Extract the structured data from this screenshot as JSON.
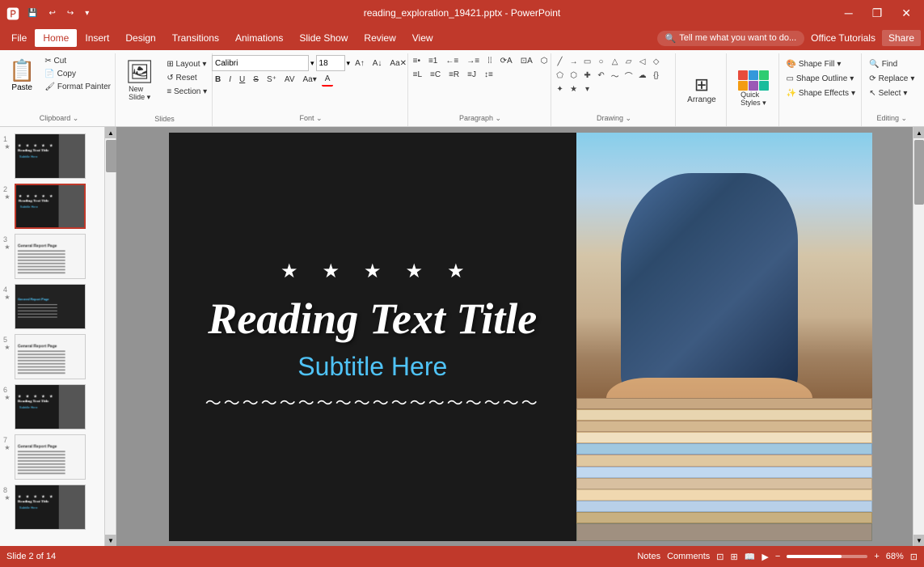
{
  "titlebar": {
    "filename": "reading_exploration_19421.pptx - PowerPoint",
    "qat": [
      "save",
      "undo",
      "redo",
      "customize"
    ],
    "winbtns": [
      "minimize",
      "restore",
      "close"
    ]
  },
  "menubar": {
    "items": [
      "File",
      "Home",
      "Insert",
      "Design",
      "Transitions",
      "Animations",
      "Slide Show",
      "Review",
      "View"
    ],
    "active": "Home",
    "help_placeholder": "Tell me what you want to do...",
    "office_tutorials": "Office Tutorials",
    "share": "Share"
  },
  "ribbon": {
    "groups": [
      {
        "name": "Clipboard",
        "label": "Clipboard",
        "buttons": [
          "Paste",
          "Cut",
          "Copy",
          "Format Painter"
        ]
      },
      {
        "name": "Slides",
        "label": "Slides",
        "buttons": [
          "New Slide",
          "Layout",
          "Reset",
          "Section"
        ]
      },
      {
        "name": "Font",
        "label": "Font",
        "font_name": "Calibri",
        "font_size": "18",
        "buttons": [
          "Bold",
          "Italic",
          "Underline",
          "Strikethrough",
          "Shadow",
          "Char Spacing",
          "Font Color",
          "Increase Font",
          "Decrease Font",
          "Clear Formatting",
          "Change Case"
        ]
      },
      {
        "name": "Paragraph",
        "label": "Paragraph",
        "buttons": [
          "Bullets",
          "Numbering",
          "Decrease Indent",
          "Increase Indent",
          "Left",
          "Center",
          "Right",
          "Justify",
          "Columns",
          "Line Spacing",
          "Text Direction",
          "Align Text",
          "Convert to SmartArt"
        ]
      },
      {
        "name": "Drawing",
        "label": "Drawing",
        "buttons": [
          "Line",
          "Arrow",
          "Rectangle",
          "Oval",
          "Triangle",
          "Parallelogram",
          "Hexagon",
          "Arrow shapes",
          "Equation shapes",
          "Flowchart",
          "Stars",
          "Callouts"
        ]
      },
      {
        "name": "Arrange",
        "label": "Arrange",
        "button_label": "Arrange"
      },
      {
        "name": "QuickStyles",
        "label": "Quick Styles"
      },
      {
        "name": "ShapeFormat",
        "shape_fill": "Shape Fill",
        "shape_outline": "Shape Outline",
        "shape_effects": "Shape Effects"
      },
      {
        "name": "Editing",
        "label": "Editing",
        "find": "Find",
        "replace": "Replace",
        "select": "Select"
      }
    ]
  },
  "slides": {
    "items": [
      {
        "num": "1",
        "starred": true,
        "theme": "dark"
      },
      {
        "num": "2",
        "starred": true,
        "theme": "dark",
        "active": true
      },
      {
        "num": "3",
        "starred": true,
        "theme": "light"
      },
      {
        "num": "4",
        "starred": true,
        "theme": "dark-shirt"
      },
      {
        "num": "5",
        "starred": true,
        "theme": "light"
      },
      {
        "num": "6",
        "starred": true,
        "theme": "dark-text"
      },
      {
        "num": "7",
        "starred": true,
        "theme": "light-books"
      },
      {
        "num": "8",
        "starred": true,
        "theme": "dark-text"
      }
    ]
  },
  "current_slide": {
    "stars": [
      "★",
      "★",
      "★",
      "★",
      "★"
    ],
    "title": "Reading Text Title",
    "subtitle": "Subtitle Here",
    "divider": "〜〜〜〜〜〜〜〜〜〜〜〜〜〜〜〜〜〜"
  },
  "statusbar": {
    "slide_info": "Slide 2 of 14",
    "notes": "Notes",
    "comments": "Comments",
    "zoom": "68%",
    "zoom_value": 68
  }
}
